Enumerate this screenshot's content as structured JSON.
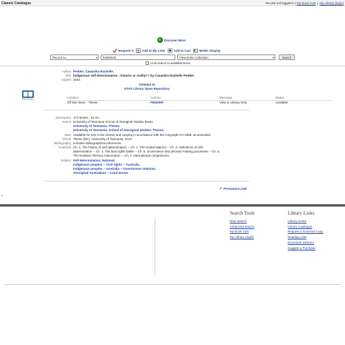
{
  "topbar": {
    "title": "Classic Catalogue",
    "status_text": "You are not logged in |",
    "book_cart": "My Book Cart",
    "separator": "|",
    "library_login": "My Library (login)",
    "caret": "⌄"
  },
  "discover_more": "Discover More",
  "actions": {
    "request": "Request it",
    "add_to_lists": "Add to My Lists",
    "add_to_cart": "Add to Cart",
    "marc": "MARC Display"
  },
  "search": {
    "type": "Record no.",
    "term": "b1540046",
    "scope": "View Entire Collection",
    "button": "Search",
    "limit_label": "Limit search to available items"
  },
  "book_icon_label": "Print Thesis",
  "record": {
    "author_label": "Author",
    "author": "Pedder, Casandra Rachelle.",
    "title_label": "Title",
    "title": "Indigenous self-determination : rhetoric or reality? / by Casandra Rachelle Pedder.",
    "imprint_label": "Imprint",
    "imprint": "2010.",
    "connect_heading": "Connect to",
    "connect_link": "UTAS Library Open Repository"
  },
  "holdings": {
    "headers": [
      "Location",
      "Call No.",
      "Message",
      "Status"
    ],
    "rows": [
      [
        "Off Site Store - Thesis",
        "PEDDER",
        "View in Library Only",
        "Available"
      ]
    ]
  },
  "details": {
    "description_label": "Description",
    "description": "173 leaves ; 31 cm.",
    "series_label": "Series",
    "series": [
      "University of Tasmania School of Aboriginal Studies thesis.",
      "University of Tasmania. Theses.",
      "University of Tasmania. School of Aboriginal Studies. Theses."
    ],
    "note_label": "Note",
    "note": "Available for use in the Library and copying in accordance with the Copyright Act 1968, as amended.",
    "thesis_label": "Thesis",
    "thesis": "Thesis (MA)--University of Tasmania, 2010.",
    "bibliography_label": "Bibliography",
    "bibliography": "Includes bibliographical references.",
    "contents_label": "Contents",
    "contents": [
      "Ch. 1. The history of self-determination -- Ch. 2. The United Nations -- Ch. 3. Definitions of self-",
      "determination -- Ch. 4. The land rights battle -- Ch. 5. Governance and decision-making processes -- Ch. 6.",
      "The Northern Territory intervention -- Ch. 7. International comparisons."
    ],
    "subject_label": "Subject",
    "subjects": [
      "Self-determination, National.",
      "Indigenous peoples -- Civil rights -- Australia.",
      "Indigenous peoples -- Australia -- Government relations.",
      "Aboriginal Australians -- Land tenure."
    ]
  },
  "permanent_link": "Permanent Link",
  "footer": {
    "search_tools_heading": "Search Tools",
    "search_tools": [
      "New Search",
      "Advanced Search",
      "My Book Cart",
      "My Library (login)"
    ],
    "library_links_heading": "Library Links",
    "library_links": [
      "Library Home",
      "Library Catalogue",
      "Request a Scanned Copy",
      "Reading Lists",
      "Document Delivery",
      "Suggest a Purchase"
    ]
  }
}
